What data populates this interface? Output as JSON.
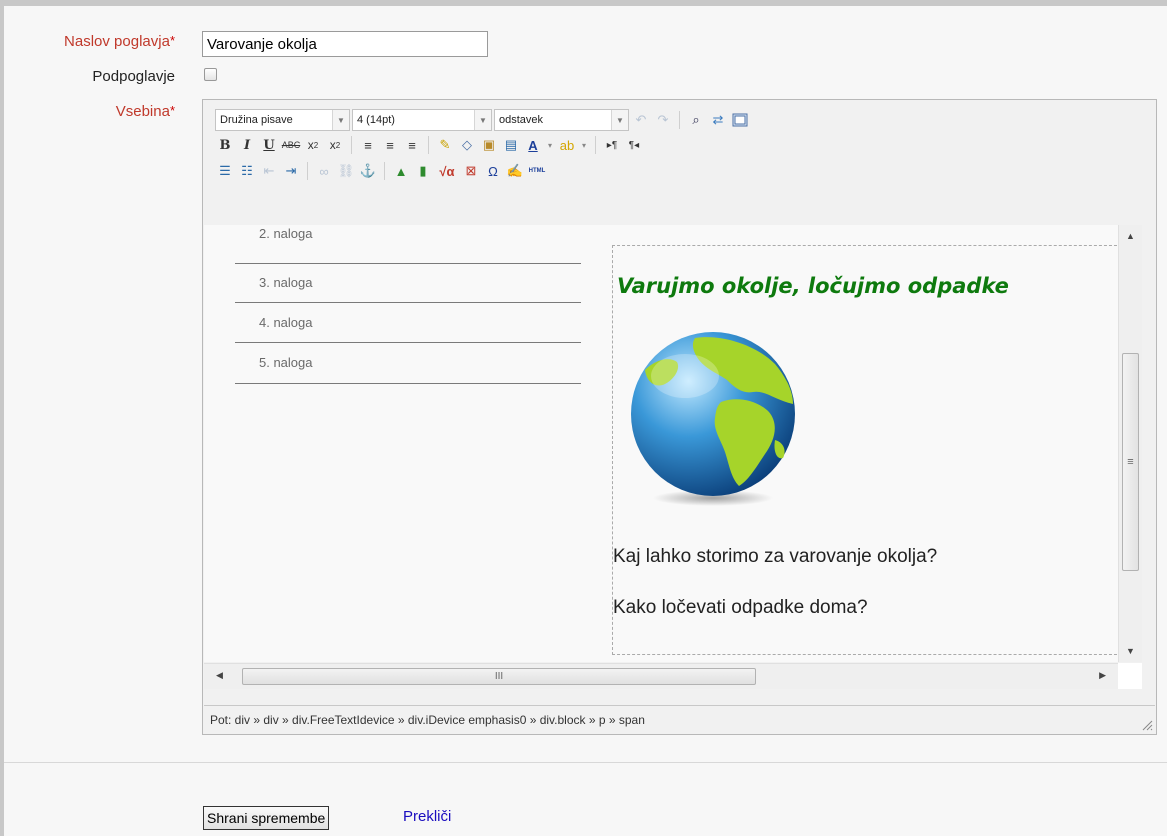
{
  "form": {
    "title_label": "Naslov poglavja",
    "title_value": "Varovanje okolja",
    "subchapter_label": "Podpoglavje",
    "content_label": "Vsebina",
    "required_mark": "*"
  },
  "editor": {
    "font_family_select": "Družina pisave",
    "font_size_select": "4 (14pt)",
    "format_select": "odstavek",
    "list_items": [
      "2. naloga",
      "3. naloga",
      "4. naloga",
      "5. naloga"
    ],
    "heading": "Varujmo okolje, ločujmo odpadke",
    "paragraph_1": "Kaj lahko storimo za varovanje okolja?",
    "paragraph_2": "Kako ločevati odpadke doma?",
    "status_path": "Pot: div » div » div.FreeTextIdevice » div.iDevice emphasis0 » div.block » p » span",
    "html_button": "HTML"
  },
  "actions": {
    "save_label": "Shrani spremembe",
    "cancel_label": "Prekliči"
  },
  "colors": {
    "required": "#c0392b",
    "heading_green": "#0e7a0e",
    "link_blue": "#1a0dbf"
  }
}
